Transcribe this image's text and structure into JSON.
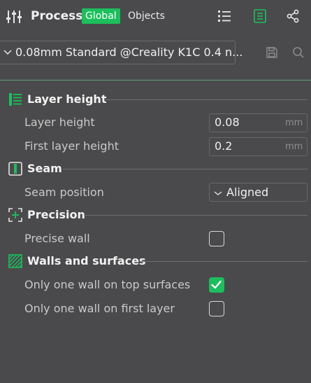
{
  "header": {
    "icon": "process-sliders-icon",
    "title": "Process",
    "tabs": [
      {
        "label": "Global",
        "active": true
      },
      {
        "label": "Objects",
        "active": false
      }
    ],
    "right_icons": [
      "list-view-icon",
      "compare-icon",
      "connection-icon"
    ]
  },
  "preset": {
    "name": "0.08mm Standard @Creality K1C 0.4 n...",
    "icons": [
      "save-icon",
      "search-icon"
    ]
  },
  "sections": [
    {
      "title": "Layer height",
      "icon": "layer-height-icon",
      "items": [
        {
          "label": "Layer height",
          "type": "number",
          "value": "0.08",
          "unit": "mm"
        },
        {
          "label": "First layer height",
          "type": "number",
          "value": "0.2",
          "unit": "mm"
        }
      ]
    },
    {
      "title": "Seam",
      "icon": "seam-icon",
      "items": [
        {
          "label": "Seam position",
          "type": "select",
          "value": "Aligned"
        }
      ]
    },
    {
      "title": "Precision",
      "icon": "precision-icon",
      "items": [
        {
          "label": "Precise wall",
          "type": "checkbox",
          "checked": false
        }
      ]
    },
    {
      "title": "Walls and surfaces",
      "icon": "walls-surfaces-icon",
      "items": [
        {
          "label": "Only one wall on top surfaces",
          "type": "checkbox",
          "checked": true
        },
        {
          "label": "Only one wall on first layer",
          "type": "checkbox",
          "checked": false
        }
      ]
    }
  ],
  "colors": {
    "background": "#4a4a4c",
    "accent": "#1bbf5c",
    "text": "#e6e6e6",
    "muted_text": "#c9c9c9"
  }
}
